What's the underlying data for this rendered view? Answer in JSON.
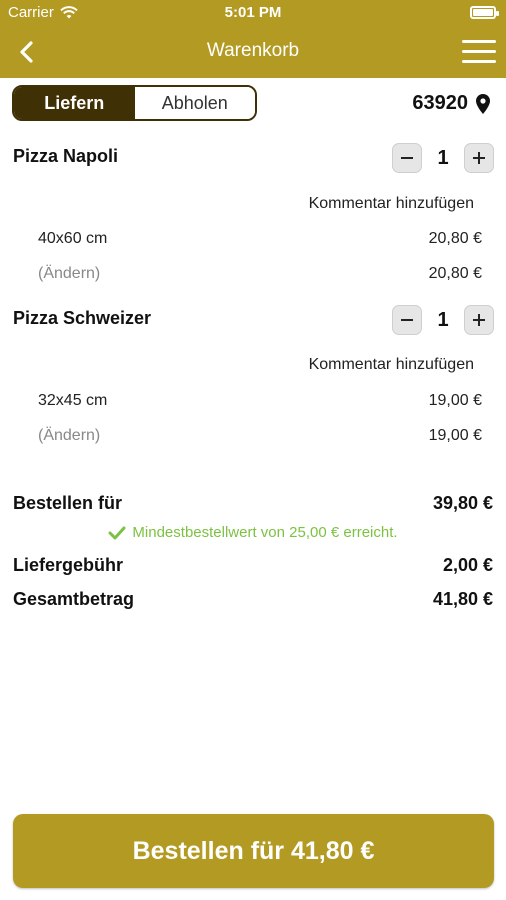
{
  "status_bar": {
    "carrier": "Carrier",
    "time": "5:01 PM"
  },
  "nav": {
    "title": "Warenkorb"
  },
  "delivery_toggle": {
    "options": [
      "Liefern",
      "Abholen"
    ],
    "selected": "Liefern"
  },
  "zip": "63920",
  "items": [
    {
      "name": "Pizza Napoli",
      "quantity": "1",
      "comment_label": "Kommentar hinzufügen",
      "size": "40x60 cm",
      "size_price": "20,80 €",
      "change_label": "(Ändern)",
      "total_price": "20,80 €"
    },
    {
      "name": "Pizza Schweizer",
      "quantity": "1",
      "comment_label": "Kommentar hinzufügen",
      "size": "32x45 cm",
      "size_price": "19,00 €",
      "change_label": "(Ändern)",
      "total_price": "19,00 €"
    }
  ],
  "summary": {
    "order_for_label": "Bestellen für",
    "order_for_value": "39,80 €",
    "minimum_message": "Mindestbestellwert von 25,00 € erreicht.",
    "delivery_fee_label": "Liefergebühr",
    "delivery_fee_value": "2,00 €",
    "total_label": "Gesamtbetrag",
    "total_value": "41,80 €"
  },
  "cta": {
    "label": "Bestellen für 41,80 €"
  },
  "colors": {
    "brand": "#b39a22",
    "dark": "#3f3006",
    "success": "#7cc242"
  }
}
